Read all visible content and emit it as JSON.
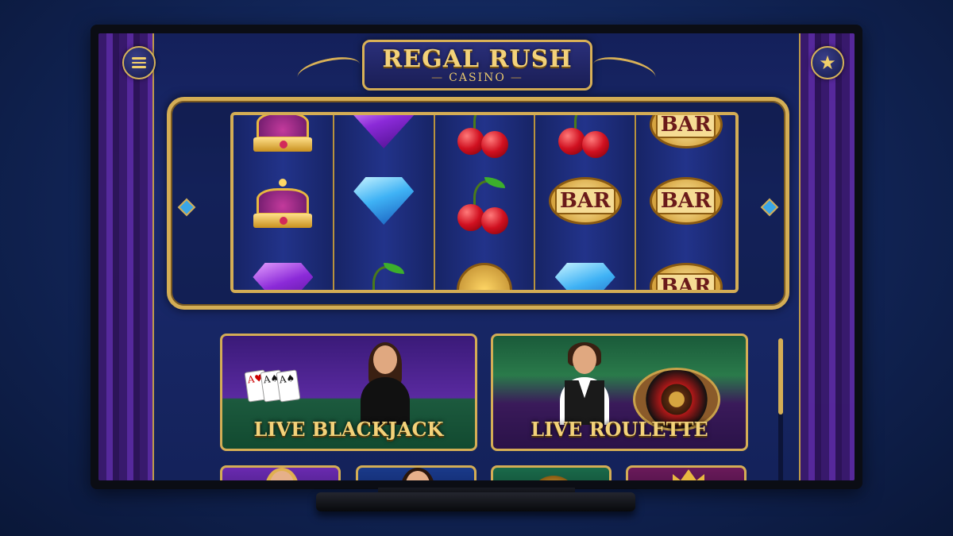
{
  "header": {
    "logo_title": "REGAL RUSH",
    "logo_subtitle": "CASINO",
    "menu_icon": "hamburger-menu-icon",
    "favorite_icon": "star-icon"
  },
  "slot": {
    "reels": [
      [
        "crown",
        "crown",
        "purple-gem"
      ],
      [
        "purple-gem",
        "blue-gem",
        "cherries"
      ],
      [
        "cherries",
        "cherries",
        "coin"
      ],
      [
        "cherries",
        "bar",
        "blue-gem"
      ],
      [
        "bar",
        "bar",
        "bar"
      ]
    ],
    "bar_label": "BAR"
  },
  "live_games": [
    {
      "label": "LIVE BLACKJACK"
    },
    {
      "label": "LIVE ROULETTE"
    }
  ],
  "colors": {
    "gold": "#d4ad55",
    "background": "#112456",
    "purple": "#5a2aa0"
  }
}
